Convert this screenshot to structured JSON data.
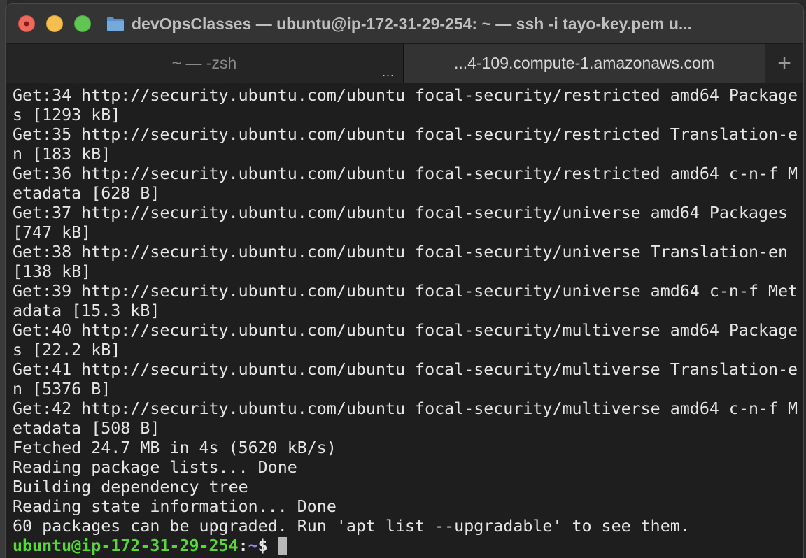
{
  "window": {
    "title": "devOpsClasses — ubuntu@ip-172-31-29-254: ~ — ssh -i tayo-key.pem u..."
  },
  "tabs": [
    {
      "label": "~ — -zsh",
      "more": "...",
      "active": false
    },
    {
      "label": "...4-109.compute-1.amazonaws.com",
      "active": true
    }
  ],
  "new_tab_label": "+",
  "terminal": {
    "lines": [
      "Get:34 http://security.ubuntu.com/ubuntu focal-security/restricted amd64 Package",
      "s [1293 kB]",
      "Get:35 http://security.ubuntu.com/ubuntu focal-security/restricted Translation-e",
      "n [183 kB]",
      "Get:36 http://security.ubuntu.com/ubuntu focal-security/restricted amd64 c-n-f M",
      "etadata [628 B]",
      "Get:37 http://security.ubuntu.com/ubuntu focal-security/universe amd64 Packages",
      "[747 kB]",
      "Get:38 http://security.ubuntu.com/ubuntu focal-security/universe Translation-en",
      "[138 kB]",
      "Get:39 http://security.ubuntu.com/ubuntu focal-security/universe amd64 c-n-f Met",
      "adata [15.3 kB]",
      "Get:40 http://security.ubuntu.com/ubuntu focal-security/multiverse amd64 Package",
      "s [22.2 kB]",
      "Get:41 http://security.ubuntu.com/ubuntu focal-security/multiverse Translation-e",
      "n [5376 B]",
      "Get:42 http://security.ubuntu.com/ubuntu focal-security/multiverse amd64 c-n-f M",
      "etadata [508 B]",
      "Fetched 24.7 MB in 4s (5620 kB/s)",
      "Reading package lists... Done",
      "Building dependency tree",
      "Reading state information... Done",
      "60 packages can be upgraded. Run 'apt list --upgradable' to see them."
    ],
    "prompt": {
      "user_host": "ubuntu@ip-172-31-29-254",
      "separator": ":",
      "path": "~",
      "symbol": "$"
    }
  },
  "colors": {
    "prompt_user": "#59d63a",
    "prompt_path": "#8b87f0",
    "terminal_bg": "#1e1e1e",
    "terminal_text": "#e6e6e6"
  },
  "icons": {
    "close": "close-icon",
    "minimize": "minimize-icon",
    "maximize": "maximize-icon",
    "folder": "folder-icon",
    "new_tab": "plus-icon"
  }
}
